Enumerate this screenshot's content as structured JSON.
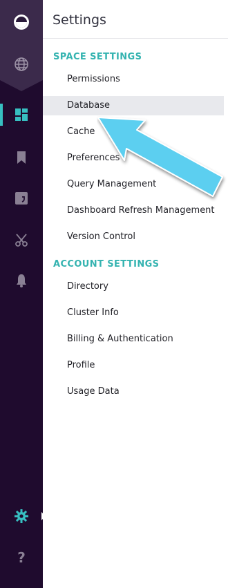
{
  "panel": {
    "title": "Settings"
  },
  "sections": [
    {
      "heading": "SPACE SETTINGS",
      "items": [
        "Permissions",
        "Database",
        "Cache",
        "Preferences",
        "Query Management",
        "Dashboard Refresh Management",
        "Version Control"
      ]
    },
    {
      "heading": "ACCOUNT SETTINGS",
      "items": [
        "Directory",
        "Cluster Info",
        "Billing & Authentication",
        "Profile",
        "Usage Data"
      ]
    }
  ],
  "active_item": "Database",
  "rail": {
    "icons": [
      "logo-icon",
      "globe-icon",
      "dashboard-grid-icon",
      "bookmark-icon",
      "quote-icon",
      "scissors-icon",
      "bell-icon",
      "gear-icon",
      "help-icon"
    ],
    "active_icon": "dashboard-grid-icon"
  },
  "colors": {
    "rail_bg": "#1f0b2e",
    "rail_top_bg": "#3b2a4b",
    "accent": "#37bfc1",
    "section_heading": "#34b3b0",
    "arrow": "#5ccff0"
  }
}
